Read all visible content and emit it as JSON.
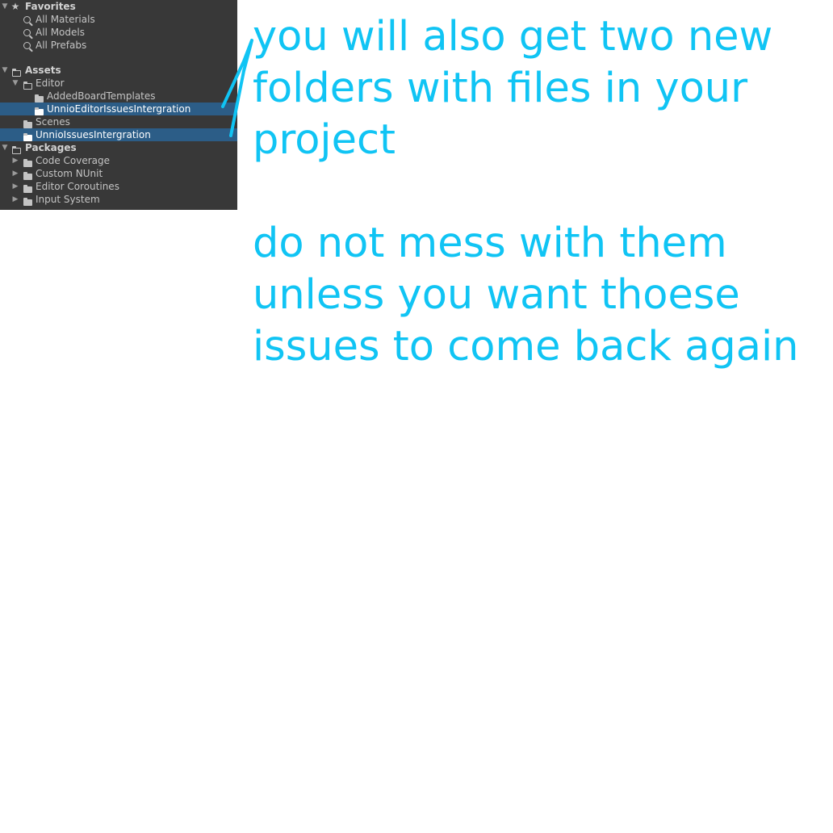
{
  "project_panel": {
    "favorites": {
      "label": "Favorites",
      "items": [
        {
          "label": "All Materials"
        },
        {
          "label": "All Models"
        },
        {
          "label": "All Prefabs"
        }
      ]
    },
    "assets": {
      "label": "Assets",
      "editor": {
        "label": "Editor",
        "children": [
          {
            "label": "AddedBoardTemplates"
          },
          {
            "label": "UnnioEditorIssuesIntergration"
          }
        ]
      },
      "scenes": {
        "label": "Scenes"
      },
      "issues_folder": {
        "label": "UnnioIssuesIntergration"
      }
    },
    "packages": {
      "label": "Packages",
      "items": [
        {
          "label": "Code Coverage"
        },
        {
          "label": "Custom NUnit"
        },
        {
          "label": "Editor Coroutines"
        },
        {
          "label": "Input System"
        }
      ]
    }
  },
  "annotation": {
    "color": "#10c4f4",
    "lines": [
      "you will also get two new",
      "folders with files in your",
      "project",
      "do not mess with them",
      "unless you want thoese",
      "issues to come back again"
    ]
  }
}
